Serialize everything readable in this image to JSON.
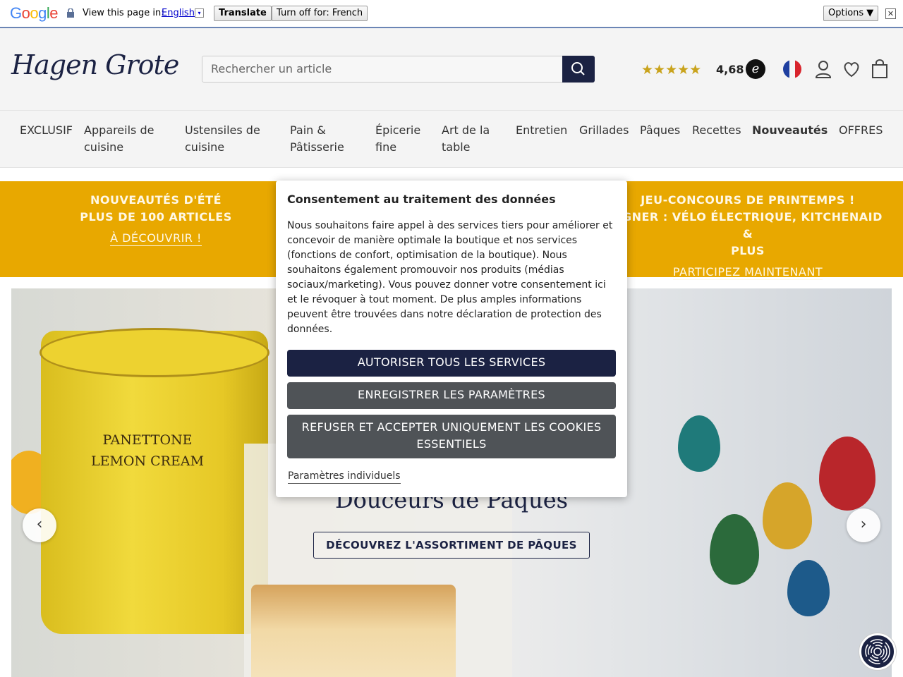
{
  "google_bar": {
    "logo": "Google",
    "view_text": "View this page in:",
    "language": "English",
    "dropdown_glyph": "▾",
    "translate_label": "Translate",
    "turn_off_label": "Turn off for: French",
    "options_label": "Options ▼",
    "close_glyph": "✕"
  },
  "header": {
    "logo": "Hagen Grote",
    "search_placeholder": "Rechercher un article",
    "stars": "★★★★★",
    "rating": "4,68",
    "trusted_mark": "e"
  },
  "nav": {
    "items": [
      "EXCLUSIF",
      "Appareils de cuisine",
      "Ustensiles de cuisine",
      "Pain & Pâtisserie",
      "Épicerie fine",
      "Art de la table",
      "Entretien",
      "Grillades",
      "Pâques",
      "Recettes",
      "Nouveautés",
      "OFFRES"
    ]
  },
  "promo": {
    "left_line1": "NOUVEAUTÉS D'ÉTÉ",
    "left_line2": "PLUS DE 100 ARTICLES",
    "left_link": "À DÉCOUVRIR !",
    "right_line1": "JEU-CONCOURS DE PRINTEMPS !",
    "right_line2": "AGNER : VÉLO ÉLECTRIQUE, KITCHENAID &",
    "right_line3": "PLUS",
    "right_link": "PARTICIPEZ MAINTENANT"
  },
  "hero": {
    "tin_line1": "PANETTONE",
    "tin_line2": "LEMON CREAM",
    "title": "Douceurs de Pâques",
    "cta": "DÉCOUVREZ L'ASSORTIMENT DE PÂQUES",
    "prev_glyph": "‹",
    "next_glyph": "›"
  },
  "consent": {
    "title": "Consentement au traitement des données",
    "text": "Nous souhaitons faire appel à des services tiers pour améliorer et concevoir de manière optimale la boutique et nos services (fonctions de confort, optimisation de la boutique). Nous souhaitons également promouvoir nos produits (médias sociaux/marketing). Vous pouvez donner votre consentement ici et le révoquer à tout moment. De plus amples informations peuvent être trouvées dans notre déclaration de protection des données.",
    "accept_all": "AUTORISER TOUS LES SERVICES",
    "save": "ENREGISTRER LES PARAMÈTRES",
    "refuse": "REFUSER ET ACCEPTER UNIQUEMENT LES COOKIES ESSENTIELS",
    "individual": "Paramètres individuels"
  },
  "colors": {
    "brand_navy": "#1b2243",
    "promo_yellow": "#e8a800",
    "button_gray": "#4f5357"
  },
  "icons": [
    "lock-icon",
    "search-icon",
    "user-icon",
    "heart-icon",
    "bag-icon",
    "fingerprint-icon",
    "chevron-left-icon",
    "chevron-right-icon"
  ]
}
